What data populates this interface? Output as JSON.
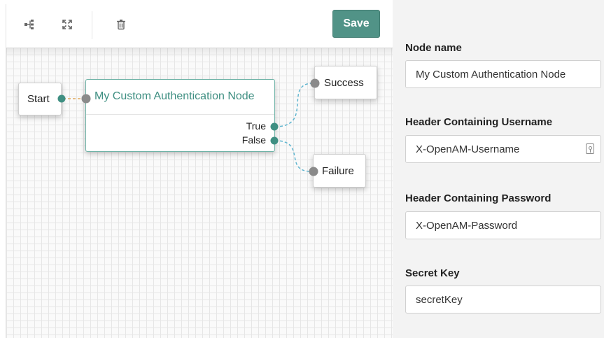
{
  "toolbar": {
    "icons": [
      "tree-layout-icon",
      "expand-icon",
      "trash-icon"
    ],
    "save_label": "Save"
  },
  "canvas": {
    "nodes": {
      "start": {
        "label": "Start"
      },
      "custom": {
        "title": "My Custom Authentication Node",
        "outcomes": [
          "True",
          "False"
        ]
      },
      "success": {
        "label": "Success"
      },
      "failure": {
        "label": "Failure"
      }
    },
    "colors": {
      "accent": "#519387",
      "node_title": "#3f8f82",
      "connector_start": "#e0a75a",
      "connector_outcome": "#5fb5cf",
      "port_connected": "#3f8f82",
      "port_input": "#8a8a8a"
    }
  },
  "panel": {
    "fields": [
      {
        "label": "Node name",
        "value": "My Custom Authentication Node"
      },
      {
        "label": "Header Containing Username",
        "value": "X-OpenAM-Username",
        "icon": "key-icon"
      },
      {
        "label": "Header Containing Password",
        "value": "X-OpenAM-Password"
      },
      {
        "label": "Secret Key",
        "value": "secretKey"
      }
    ]
  }
}
